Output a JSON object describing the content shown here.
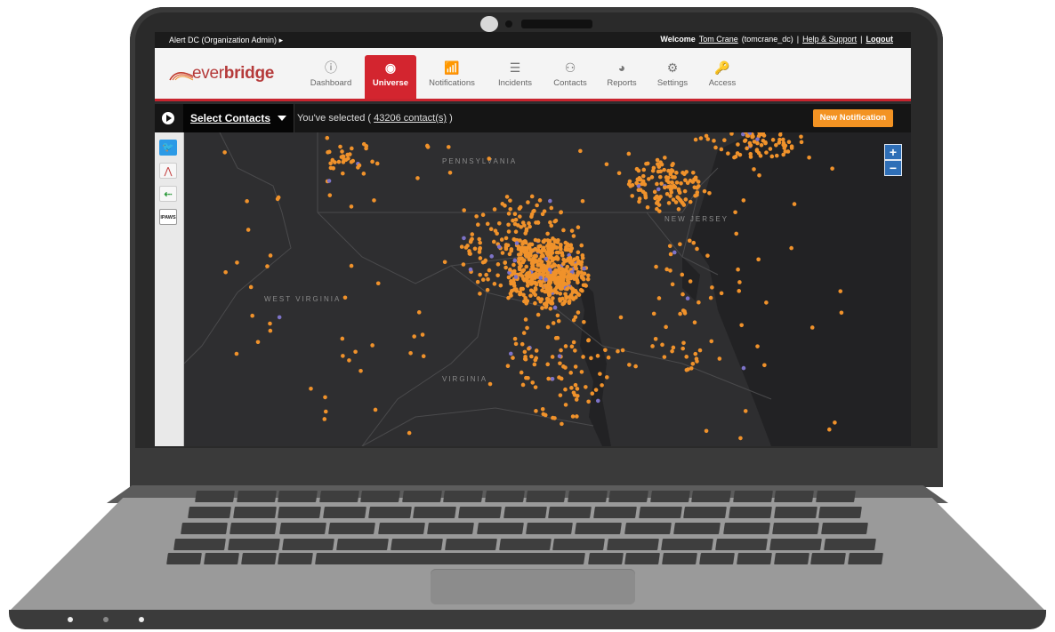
{
  "topbar": {
    "org": "Alert DC (Organization Admin)",
    "welcome": "Welcome",
    "user_name": "Tom Crane",
    "user_handle": "(tomcrane_dc)",
    "sep": "|",
    "help": "Help & Support",
    "logout": "Logout"
  },
  "brand": {
    "logo_ever": "ever",
    "logo_bridge": "bridge",
    "accent": "#d3252f",
    "action_color": "#f39323"
  },
  "nav": {
    "items": [
      {
        "label": "Dashboard",
        "icon": "dashboard-icon"
      },
      {
        "label": "Universe",
        "icon": "globe-icon",
        "active": true
      },
      {
        "label": "Notifications",
        "icon": "broadcast-icon"
      },
      {
        "label": "Incidents",
        "icon": "list-icon"
      },
      {
        "label": "Contacts",
        "icon": "people-icon"
      },
      {
        "label": "Reports",
        "icon": "pie-chart-icon"
      },
      {
        "label": "Settings",
        "icon": "gear-icon"
      },
      {
        "label": "Access",
        "icon": "key-icon"
      }
    ]
  },
  "selectbar": {
    "select_label": "Select Contacts",
    "selected_prefix": "You've selected (",
    "selected_count": "43206 contact(s)",
    "selected_suffix": ")",
    "new_notification": "New Notification"
  },
  "toolbar": {
    "tools": [
      "twitter-icon",
      "everbridge-icon",
      "share-icon",
      "ipaws-icon"
    ],
    "ipaws_text": "IPAWS"
  },
  "map": {
    "states": [
      "PENNSYLVANIA",
      "NEW JERSEY",
      "WEST VIRGINIA",
      "VIRGINIA"
    ],
    "zoom_in": "+",
    "zoom_out": "−",
    "dot_color": "#f0922b",
    "cluster_color": "#7d73c8"
  }
}
